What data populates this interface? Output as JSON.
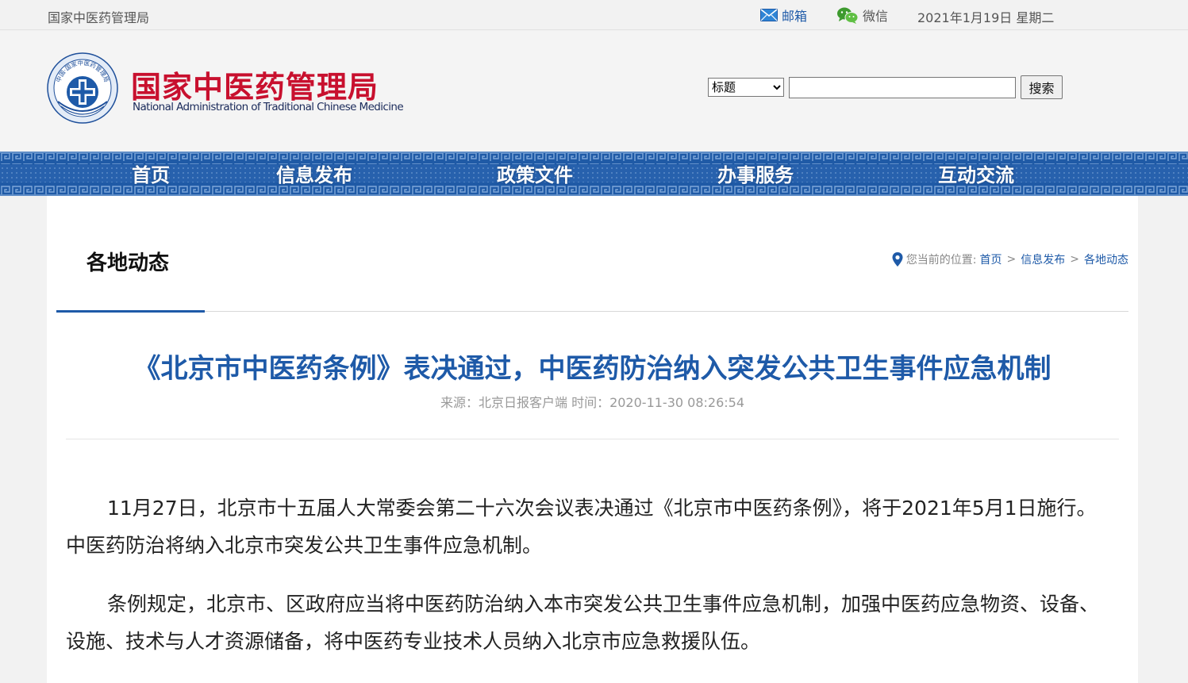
{
  "topbar": {
    "site_name": "国家中医药管理局",
    "mail_label": "邮箱",
    "wechat_label": "微信",
    "date": "2021年1月19日 星期二"
  },
  "header": {
    "logo_cn": "国家中医药管理局",
    "logo_en": "National Administration of Traditional Chinese Medicine",
    "emblem_text": "中国·国家中医药管理局"
  },
  "search": {
    "select_value": "标题",
    "options": [
      "标题"
    ],
    "input_value": "",
    "button_label": "搜索"
  },
  "nav": {
    "items": [
      {
        "label": "首页"
      },
      {
        "label": "信息发布"
      },
      {
        "label": "政策文件"
      },
      {
        "label": "办事服务"
      },
      {
        "label": "互动交流"
      }
    ]
  },
  "section": {
    "title": "各地动态"
  },
  "breadcrumb": {
    "prefix": "您当前的位置:",
    "items": [
      "首页",
      "信息发布",
      "各地动态"
    ],
    "separator": ">"
  },
  "article": {
    "title": "《北京市中医药条例》表决通过，中医药防治纳入突发公共卫生事件应急机制",
    "meta": "来源：北京日报客户端 时间：2020-11-30 08:26:54",
    "paragraphs": [
      "11月27日，北京市十五届人大常委会第二十六次会议表决通过《北京市中医药条例》，将于2021年5月1日施行。中医药防治将纳入北京市突发公共卫生事件应急机制。",
      "条例规定，北京市、区政府应当将中医药防治纳入本市突发公共卫生事件应急机制，加强中医药应急物资、设备、设施、技术与人才资源储备，将中医药专业技术人员纳入北京市应急救援队伍。"
    ]
  },
  "colors": {
    "brand_red": "#c8102e",
    "nav_blue": "#1f5aa6",
    "link_blue": "#1e5aa8"
  }
}
